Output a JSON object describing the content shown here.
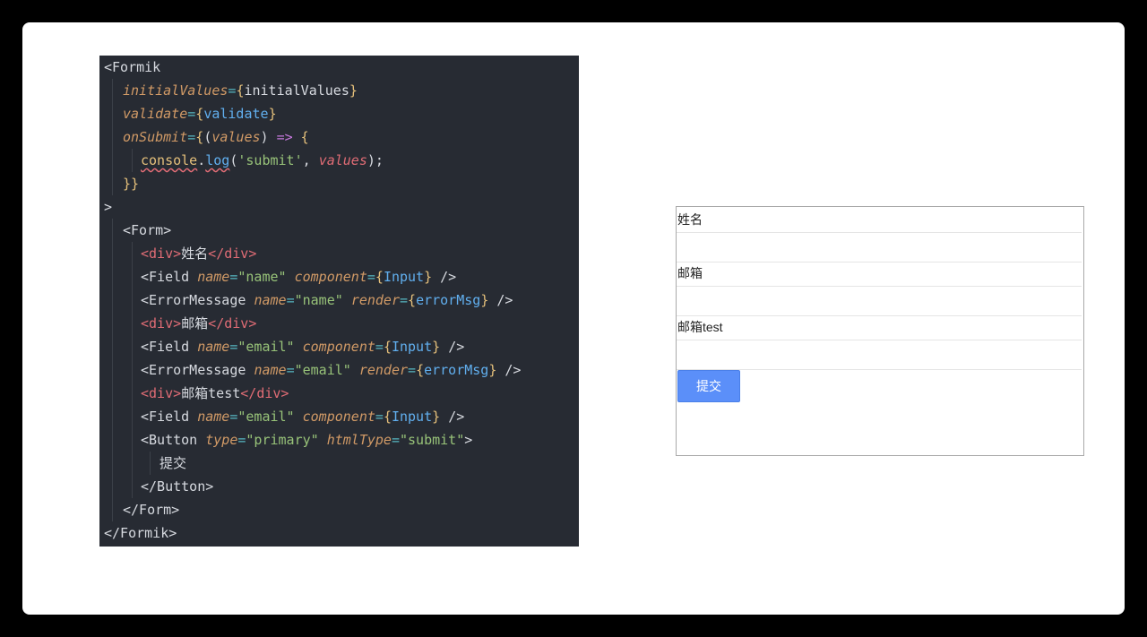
{
  "code": {
    "formik_open": "<Formik",
    "initial_values_attr": "initialValues",
    "initial_values_val": "initialValues",
    "validate_attr": "validate",
    "validate_val": "validate",
    "onsubmit_attr": "onSubmit",
    "values_param": "values",
    "arrow": "=>",
    "console": "console",
    "log": "log",
    "submit_str": "'submit'",
    "values_arg": "values",
    "close_brace": "}}",
    "gt": ">",
    "form_open": "<Form>",
    "div_open": "<div>",
    "div_close": "</div>",
    "label_name": "姓名",
    "label_email": "邮箱",
    "label_email_test": "邮箱test",
    "field_tag": "<Field",
    "name_attr": "name",
    "component_attr": "component",
    "input_comp": "Input",
    "name_val_name": "\"name\"",
    "name_val_email": "\"email\"",
    "error_tag": "<ErrorMessage",
    "render_attr": "render",
    "error_msg": "errorMsg",
    "self_close": "/>",
    "button_open": "<Button",
    "type_attr": "type",
    "type_val": "\"primary\"",
    "htmltype_attr": "htmlType",
    "htmltype_val": "\"submit\"",
    "button_text": "提交",
    "button_close": "</Button>",
    "form_close": "</Form>",
    "formik_close": "</Formik>"
  },
  "preview": {
    "label_name": "姓名",
    "label_email": "邮箱",
    "label_email_test": "邮箱test",
    "submit_label": "提交"
  }
}
